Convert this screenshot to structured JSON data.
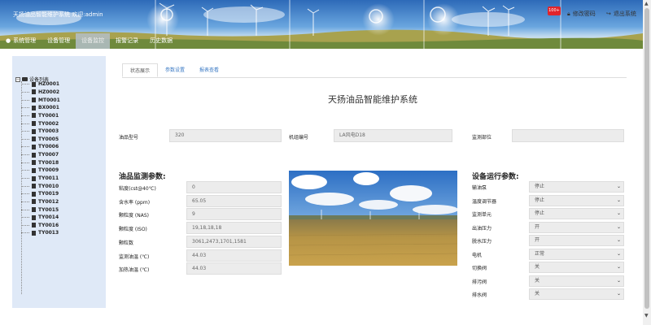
{
  "header": {
    "system_title": "天扬油品智能维护系统 欢迎:admin",
    "badge": "100+",
    "change_password": "修改密码",
    "logout": "退出系统"
  },
  "nav": {
    "items": [
      {
        "label": "系统管理",
        "icon": "home-icon"
      },
      {
        "label": "设备管理",
        "icon": ""
      },
      {
        "label": "设备监控",
        "icon": ""
      },
      {
        "label": "报警记录",
        "icon": ""
      },
      {
        "label": "历史数据",
        "icon": ""
      }
    ],
    "active_index": 2
  },
  "sidebar": {
    "root_label": "设备列表",
    "items": [
      "HZ0001",
      "HZ0002",
      "MT0001",
      "BX0001",
      "TY0001",
      "TY0002",
      "TY0003",
      "TY0005",
      "TY0006",
      "TY0007",
      "TY0018",
      "TY0009",
      "TY0011",
      "TY0010",
      "TY0019",
      "TY0012",
      "TY0015",
      "TY0014",
      "TY0016",
      "TY0013"
    ]
  },
  "tabs": [
    {
      "label": "状态展示",
      "active": true
    },
    {
      "label": "参数设置",
      "active": false
    },
    {
      "label": "报表查看",
      "active": false
    }
  ],
  "page_title": "天扬油品智能维护系统",
  "info_row": {
    "oil_model_label": "油品型号",
    "oil_model_value": "320",
    "unit_id_label": "机组编号",
    "unit_id_value": "LA风电D18",
    "monitor_part_label": "监测部位",
    "monitor_part_value": ""
  },
  "oil_params": {
    "title": "油品监测参数:",
    "rows": [
      {
        "label": "粘度(cst@40℃)",
        "value": "0"
      },
      {
        "label": "含水率 (ppm)",
        "value": "65.05"
      },
      {
        "label": "颗粒度 (NAS)",
        "value": "9"
      },
      {
        "label": "颗粒度 (ISO)",
        "value": "19,18,18,18"
      },
      {
        "label": "颗粒数",
        "value": "3061,2473,1701,1581"
      },
      {
        "label": "监测油温 (℃)",
        "value": "44.03"
      },
      {
        "label": "加热油温 (℃)",
        "value": "44.03"
      }
    ]
  },
  "device_params": {
    "title": "设备运行参数:",
    "rows": [
      {
        "label": "输油泵",
        "value": "停止"
      },
      {
        "label": "温度调节器",
        "value": "停止"
      },
      {
        "label": "监测单元",
        "value": "停止"
      },
      {
        "label": "出油压力",
        "value": "开"
      },
      {
        "label": "脱水压力",
        "value": "开"
      },
      {
        "label": "电机",
        "value": "正常"
      },
      {
        "label": "切换阀",
        "value": "关"
      },
      {
        "label": "排污阀",
        "value": "关"
      },
      {
        "label": "排水阀",
        "value": "关"
      }
    ]
  },
  "colors": {
    "sidebar_bg": "#dfe9f7",
    "tab_link": "#3a79c4",
    "badge_red": "#e0242b"
  }
}
